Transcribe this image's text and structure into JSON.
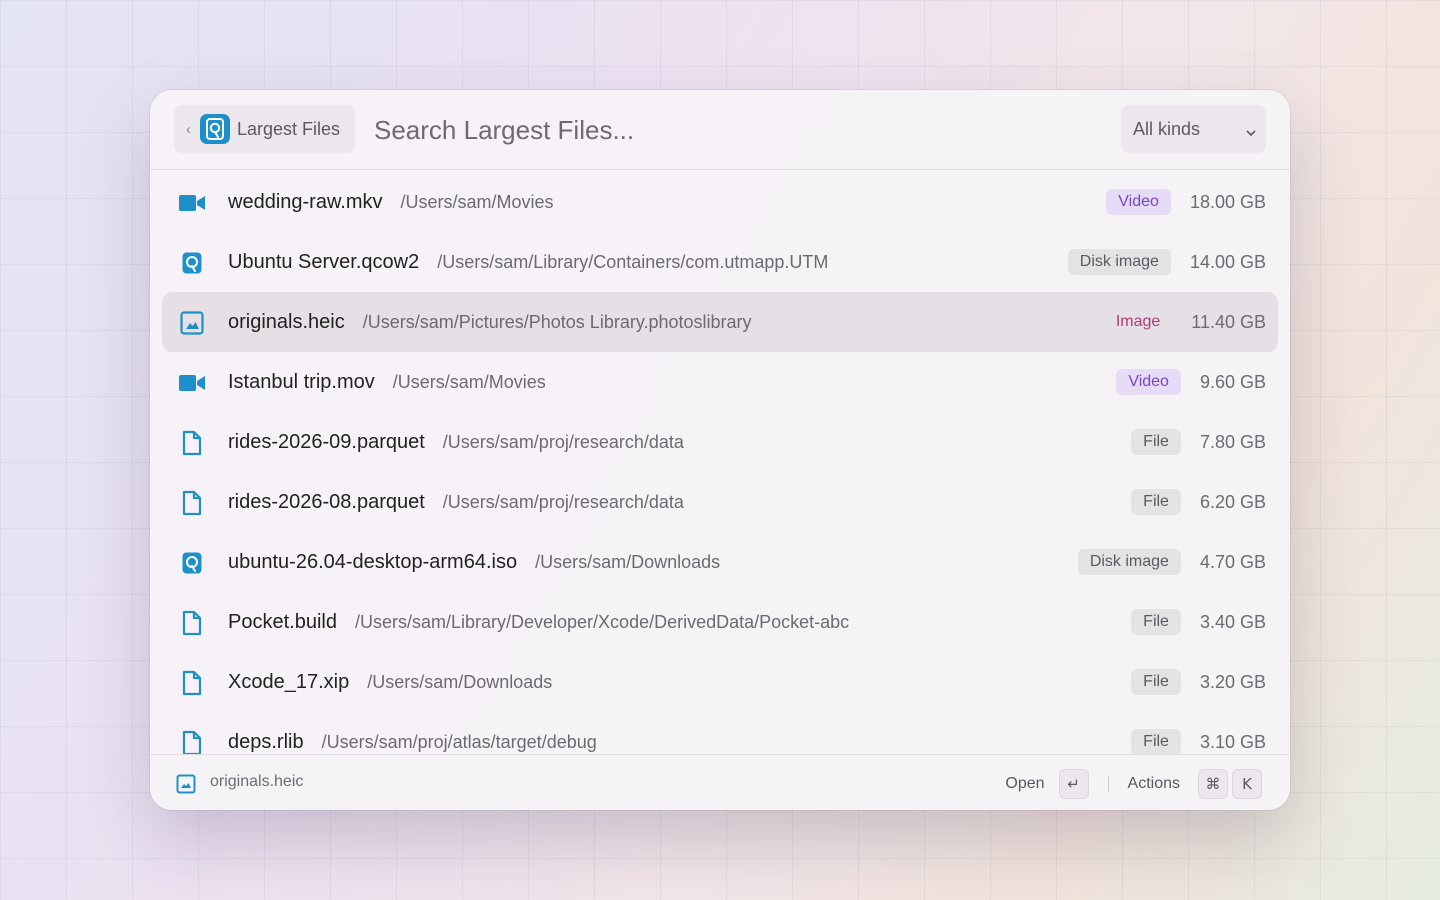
{
  "header": {
    "back_chip": {
      "label": "Largest Files",
      "chevron": "‹"
    },
    "search": {
      "placeholder": "Search Largest Files..."
    },
    "kind_filter": {
      "value": "All kinds",
      "chevron": "⌄"
    }
  },
  "files": [
    {
      "icon": "video-camera-icon",
      "name": "wedding-raw.mkv",
      "path": "/Users/sam/Movies",
      "kind": "Video",
      "kind_style": "video",
      "size": "18.00 GB",
      "selected": false
    },
    {
      "icon": "disk-image-icon",
      "name": "Ubuntu Server.qcow2",
      "path": "/Users/sam/Library/Containers/com.utmapp.UTM",
      "kind": "Disk image",
      "kind_style": "disk",
      "size": "14.00 GB",
      "selected": false
    },
    {
      "icon": "image-icon",
      "name": "originals.heic",
      "path": "/Users/sam/Pictures/Photos Library.photoslibrary",
      "kind": "Image",
      "kind_style": "image",
      "size": "11.40 GB",
      "selected": true
    },
    {
      "icon": "video-camera-icon",
      "name": "Istanbul trip.mov",
      "path": "/Users/sam/Movies",
      "kind": "Video",
      "kind_style": "video",
      "size": "9.60 GB",
      "selected": false
    },
    {
      "icon": "document-icon",
      "name": "rides-2026-09.parquet",
      "path": "/Users/sam/proj/research/data",
      "kind": "File",
      "kind_style": "file",
      "size": "7.80 GB",
      "selected": false
    },
    {
      "icon": "document-icon",
      "name": "rides-2026-08.parquet",
      "path": "/Users/sam/proj/research/data",
      "kind": "File",
      "kind_style": "file",
      "size": "6.20 GB",
      "selected": false
    },
    {
      "icon": "disk-image-icon",
      "name": "ubuntu-26.04-desktop-arm64.iso",
      "path": "/Users/sam/Downloads",
      "kind": "Disk image",
      "kind_style": "disk",
      "size": "4.70 GB",
      "selected": false
    },
    {
      "icon": "document-icon",
      "name": "Pocket.build",
      "path": "/Users/sam/Library/Developer/Xcode/DerivedData/Pocket-abc",
      "kind": "File",
      "kind_style": "file",
      "size": "3.40 GB",
      "selected": false
    },
    {
      "icon": "document-icon",
      "name": "Xcode_17.xip",
      "path": "/Users/sam/Downloads",
      "kind": "File",
      "kind_style": "file",
      "size": "3.20 GB",
      "selected": false
    },
    {
      "icon": "document-icon",
      "name": "deps.rlib",
      "path": "/Users/sam/proj/atlas/target/debug",
      "kind": "File",
      "kind_style": "file",
      "size": "3.10 GB",
      "selected": false
    }
  ],
  "footer": {
    "selected_icon": "image-icon",
    "selected_name": "originals.heic",
    "open_label": "Open",
    "open_key": "↵",
    "actions_label": "Actions",
    "actions_keys": [
      "⌘",
      "K"
    ]
  },
  "colors": {
    "accent": "#1e90c9",
    "video_badge": "#7a45c8",
    "image_badge": "#b23a77"
  }
}
